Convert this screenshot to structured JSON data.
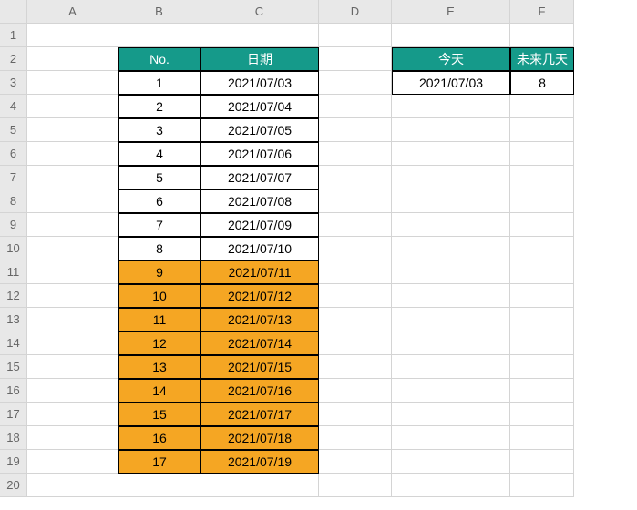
{
  "columns": [
    "A",
    "B",
    "C",
    "D",
    "E",
    "F"
  ],
  "row_count": 20,
  "main_table": {
    "headers": {
      "no": "No.",
      "date": "日期"
    },
    "rows": [
      {
        "no": "1",
        "date": "2021/07/03",
        "highlight": false
      },
      {
        "no": "2",
        "date": "2021/07/04",
        "highlight": false
      },
      {
        "no": "3",
        "date": "2021/07/05",
        "highlight": false
      },
      {
        "no": "4",
        "date": "2021/07/06",
        "highlight": false
      },
      {
        "no": "5",
        "date": "2021/07/07",
        "highlight": false
      },
      {
        "no": "6",
        "date": "2021/07/08",
        "highlight": false
      },
      {
        "no": "7",
        "date": "2021/07/09",
        "highlight": false
      },
      {
        "no": "8",
        "date": "2021/07/10",
        "highlight": false
      },
      {
        "no": "9",
        "date": "2021/07/11",
        "highlight": true
      },
      {
        "no": "10",
        "date": "2021/07/12",
        "highlight": true
      },
      {
        "no": "11",
        "date": "2021/07/13",
        "highlight": true
      },
      {
        "no": "12",
        "date": "2021/07/14",
        "highlight": true
      },
      {
        "no": "13",
        "date": "2021/07/15",
        "highlight": true
      },
      {
        "no": "14",
        "date": "2021/07/16",
        "highlight": true
      },
      {
        "no": "15",
        "date": "2021/07/17",
        "highlight": true
      },
      {
        "no": "16",
        "date": "2021/07/18",
        "highlight": true
      },
      {
        "no": "17",
        "date": "2021/07/19",
        "highlight": true
      }
    ]
  },
  "side_table": {
    "headers": {
      "today": "今天",
      "future_days": "未来几天"
    },
    "values": {
      "today": "2021/07/03",
      "future_days": "8"
    }
  }
}
